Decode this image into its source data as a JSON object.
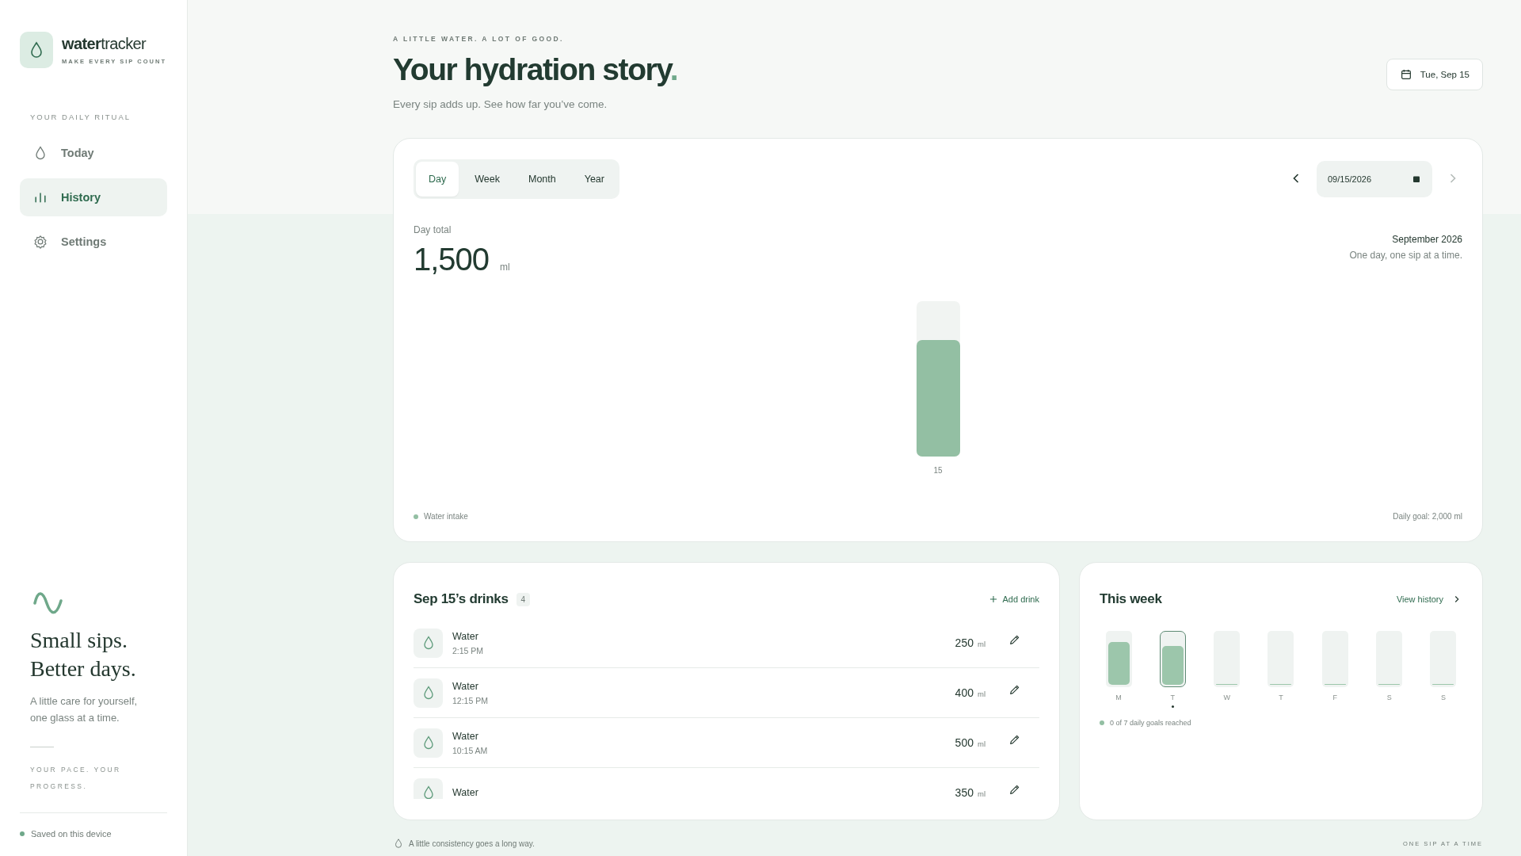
{
  "brand": {
    "name_bold": "water",
    "name_light": "tracker",
    "tagline": "MAKE EVERY SIP COUNT"
  },
  "sidebar": {
    "section_label": "YOUR DAILY RITUAL",
    "items": [
      {
        "label": "Today",
        "selected": false
      },
      {
        "label": "History",
        "selected": true
      },
      {
        "label": "Settings",
        "selected": false
      }
    ],
    "quote_line_1": "Small sips.",
    "quote_line_2": "Better days.",
    "quote_text": "A little care for yourself, one glass at a time.",
    "motto": "YOUR PACE. YOUR PROGRESS.",
    "status": "Saved on this device"
  },
  "header": {
    "eyebrow": "A LITTLE WATER. A LOT OF GOOD.",
    "title": "Your hydration story",
    "title_dot": ".",
    "subtitle": "Every sip adds up. See how far you’ve come.",
    "date_button": "Tue, Sep 15"
  },
  "history": {
    "tabs": [
      {
        "label": "Day",
        "selected": true
      },
      {
        "label": "Week",
        "selected": false
      },
      {
        "label": "Month",
        "selected": false
      },
      {
        "label": "Year",
        "selected": false
      }
    ],
    "date_value": "09/15/2026",
    "next_disabled": true,
    "total_label": "Day total",
    "total_value": "1,500",
    "total_unit": "ml",
    "period": "September 2026",
    "period_note": "One day, one sip at a time.",
    "bars": [
      {
        "label": "15",
        "level": 0.75
      }
    ],
    "legend": "Water intake",
    "goal": "Daily goal: 2,000 ml"
  },
  "drinks": {
    "title": "Sep 15’s drinks",
    "count": "4",
    "add_button": "Add drink",
    "items": [
      {
        "name": "Water",
        "time": "2:15 PM",
        "amount": "250",
        "unit": "ml"
      },
      {
        "name": "Water",
        "time": "12:15 PM",
        "amount": "400",
        "unit": "ml"
      },
      {
        "name": "Water",
        "time": "10:15 AM",
        "amount": "500",
        "unit": "ml"
      },
      {
        "name": "Water",
        "amount": "350",
        "unit": "ml"
      }
    ]
  },
  "week": {
    "title": "This week",
    "link": "View history",
    "days": [
      {
        "label": "M",
        "level": 0.83,
        "selected": false
      },
      {
        "label": "T",
        "level": 0.75,
        "selected": true
      },
      {
        "label": "W",
        "level": 0,
        "selected": false
      },
      {
        "label": "T",
        "level": 0,
        "selected": false
      },
      {
        "label": "F",
        "level": 0,
        "selected": false
      },
      {
        "label": "S",
        "level": 0,
        "selected": false
      },
      {
        "label": "S",
        "level": 0,
        "selected": false
      }
    ],
    "summary": "0 of 7 daily goals reached"
  },
  "footer": {
    "note": "A little consistency goes a long way.",
    "motto": "ONE SIP AT A TIME"
  }
}
